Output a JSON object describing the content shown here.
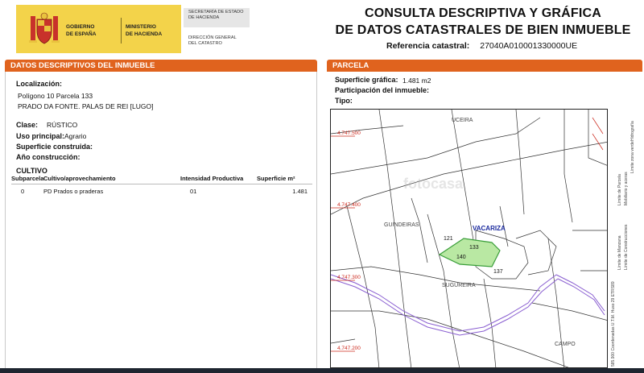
{
  "header": {
    "gobierno": "GOBIERNO\nDE ESPAÑA",
    "ministerio": "MINISTERIO\nDE HACIENDA",
    "secretaria": "SECRETARÍA DE ESTADO\nDE HACIENDA",
    "direccion": "DIRECCIÓN GENERAL\nDEL CATASTRO",
    "title_line1": "CONSULTA DESCRIPTIVA Y GRÁFICA",
    "title_line2": "DE DATOS CATASTRALES DE BIEN INMUEBLE",
    "ref_label": "Referencia catastral:",
    "ref_value": "27040A010001330000UE"
  },
  "left": {
    "section_title": "DATOS DESCRIPTIVOS DEL INMUEBLE",
    "localizacion_label": "Localización:",
    "localizacion_line1": "Polígono 10 Parcela 133",
    "localizacion_line2": "PRADO DA FONTE. PALAS DE REI [LUGO]",
    "clase_label": "Clase:",
    "clase_value": "RÚSTICO",
    "uso_label": "Uso principal:",
    "uso_value": "Agrario",
    "superficie_label": "Superficie construida:",
    "anio_label": "Año construcción:",
    "cultivo_title": "CULTIVO",
    "cultivo_headers": [
      "Subparcela",
      "Cultivo/aprovechamiento",
      "Intensidad Productiva",
      "Superficie m²"
    ],
    "cultivo_rows": [
      [
        "0",
        "PD Prados o praderas",
        "01",
        "1.481"
      ]
    ]
  },
  "right": {
    "section_title": "PARCELA",
    "superficie_label": "Superficie gráfica:",
    "superficie_value": "1.481 m2",
    "participacion_label": "Participación del inmueble:",
    "tipo_label": "Tipo:"
  },
  "map": {
    "labels": {
      "uceira": "UCEIRA",
      "guindeiras": "GUINDEIRAS",
      "vacariza": "VACARIZA",
      "sugureira": "SUGUREIRA",
      "campo": "CAMPO",
      "p121": "121",
      "p133": "133",
      "p140": "140",
      "p137": "137",
      "coord1": "4.747.500",
      "coord2": "4.747.400",
      "coord3": "4.747.300",
      "coord4": "4.747.200",
      "watermark": "fotocasa"
    },
    "legend": [
      "Límite de Manzana",
      "Límite de Parcela",
      "Límite de Construcciones",
      "Mobiliario y aceras",
      "Límite zona verde",
      "Hidrografía",
      "585.900 Coordenadas U.T.M. Huso 29 ETRS89"
    ],
    "colors": {
      "parcel_fill": "#b9e8a3",
      "parcel_stroke": "#3a9e3a",
      "road": "#8a5fd1",
      "red_label": "#cc2a1e"
    }
  }
}
